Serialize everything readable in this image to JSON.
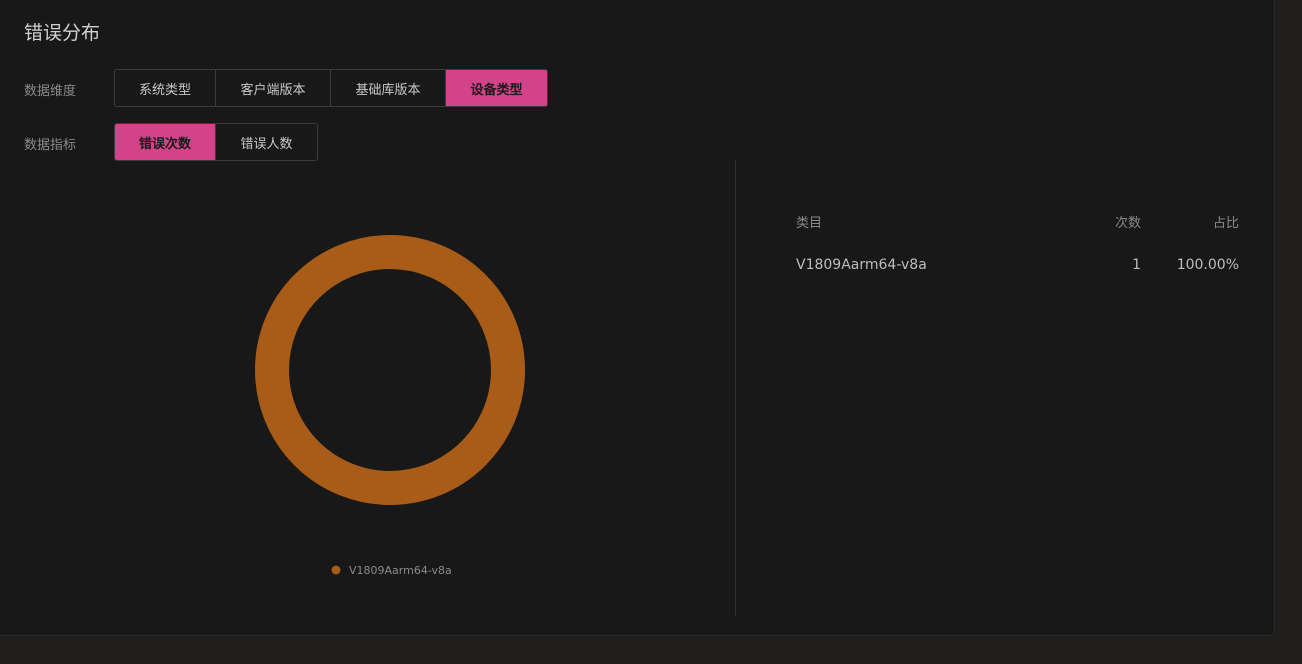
{
  "title": "错误分布",
  "dimension": {
    "label": "数据维度",
    "options": [
      "系统类型",
      "客户端版本",
      "基础库版本",
      "设备类型"
    ],
    "selected": "设备类型"
  },
  "metric": {
    "label": "数据指标",
    "options": [
      "错误次数",
      "错误人数"
    ],
    "selected": "错误次数"
  },
  "chart_data": {
    "type": "pie",
    "categories": [
      "V1809Aarm64-v8a"
    ],
    "values": [
      1
    ],
    "colors": [
      "#a85c18"
    ],
    "legend": "bottom-center"
  },
  "table": {
    "headers": [
      "类目",
      "次数",
      "占比"
    ],
    "rows": [
      {
        "category": "V1809Aarm64-v8a",
        "count": "1",
        "ratio": "100.00%"
      }
    ]
  }
}
